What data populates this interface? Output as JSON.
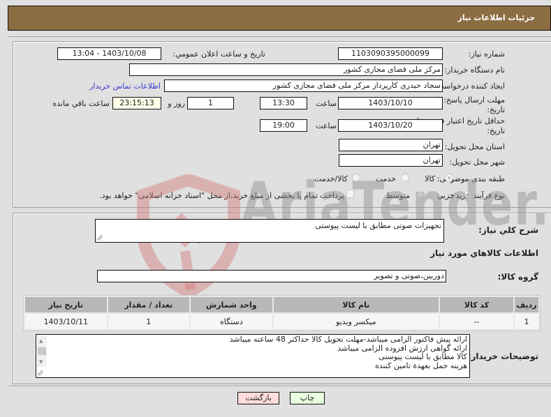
{
  "header": {
    "title": "جزئیات اطلاعات نیاز"
  },
  "form": {
    "need_number": {
      "label": "شماره نیاز:",
      "value": "1103090395000099"
    },
    "announce": {
      "label": "تاریخ و ساعت اعلان عمومي:",
      "value": "1403/10/08 - 13:04"
    },
    "buyer_org": {
      "label": "نام دستگاه خریدار:",
      "value": "مرکز ملی فضای مجازی کشور"
    },
    "requester": {
      "label": "ایجاد کننده درخواست:",
      "value": "سجاد حیدری کارپرداز مرکز ملی فضای مجازی کشور",
      "contact_link": "اطلاعات تماس خریدار"
    },
    "reply_deadline": {
      "label_line1": "مهلت ارسال پاسخ: تا",
      "label_line2": "تاریخ:",
      "date": "1403/10/10",
      "time_label": "ساعت",
      "time": "13:30",
      "days": "1",
      "days_label": "روز و",
      "remaining": "23:15:13",
      "remaining_label": "ساعت باقي مانده"
    },
    "price_validity": {
      "label_line1": "حداقل تاریخ اعتبار قیمت: تا",
      "label_line2": "تاریخ:",
      "date": "1403/10/20",
      "time_label": "ساعت",
      "time": "19:00"
    },
    "province": {
      "label": "استان محل تحویل:",
      "value": "تهران"
    },
    "city": {
      "label": "شهر محل تحویل:",
      "value": "تهران"
    },
    "category": {
      "label": "طبقه بندی موضوعی:",
      "options": [
        {
          "label": "کالا",
          "checked": true
        },
        {
          "label": "خدمت",
          "checked": false
        },
        {
          "label": "کالا/خدمت",
          "checked": false
        }
      ]
    },
    "process": {
      "label": "نوع فرآیند خرید :",
      "options": [
        {
          "label": "جزیي",
          "checked": true
        },
        {
          "label": "متوسط",
          "checked": false
        }
      ],
      "payment_note": "پرداخت تمام یا بخشی از مبلغ خرید،از محل \"اسناد خزانه اسلامی\" خواهد بود."
    }
  },
  "details": {
    "description_label": "شرح کلي نیاز:",
    "description": "تجهیزات صوتی مطابق با لیست پیوستی",
    "goods_section_title": "اطلاعات کالاهاي مورد نیاز",
    "goods_group_label": "گروه کالا:",
    "goods_group": "دوربین،صوتی و تصویر",
    "table": {
      "headers": [
        "ردیف",
        "کد کالا",
        "نام کالا",
        "واحد شمارش",
        "تعداد / مقدار",
        "تاریخ نیاز"
      ],
      "rows": [
        [
          "1",
          "--",
          "میکسر ویدیو",
          "دستگاه",
          "1",
          "1403/10/11"
        ]
      ]
    },
    "buyer_notes_label": "توضیحات خریدار:",
    "buyer_notes": [
      "ارائه پیش فاکتور الزامی میباشد-مهلت تحویل کالا حداکثر 48 ساعته میباشد",
      "ارائه گواهی ارزش افزوده الزامی میباشد",
      "کالا مطابق با لیست پیوستی",
      "هزینه حمل بعهدة تامین کننده"
    ]
  },
  "buttons": {
    "back": "بازگشت",
    "print": "چاپ"
  },
  "watermark": {
    "text": "AriaTender.neT"
  }
}
